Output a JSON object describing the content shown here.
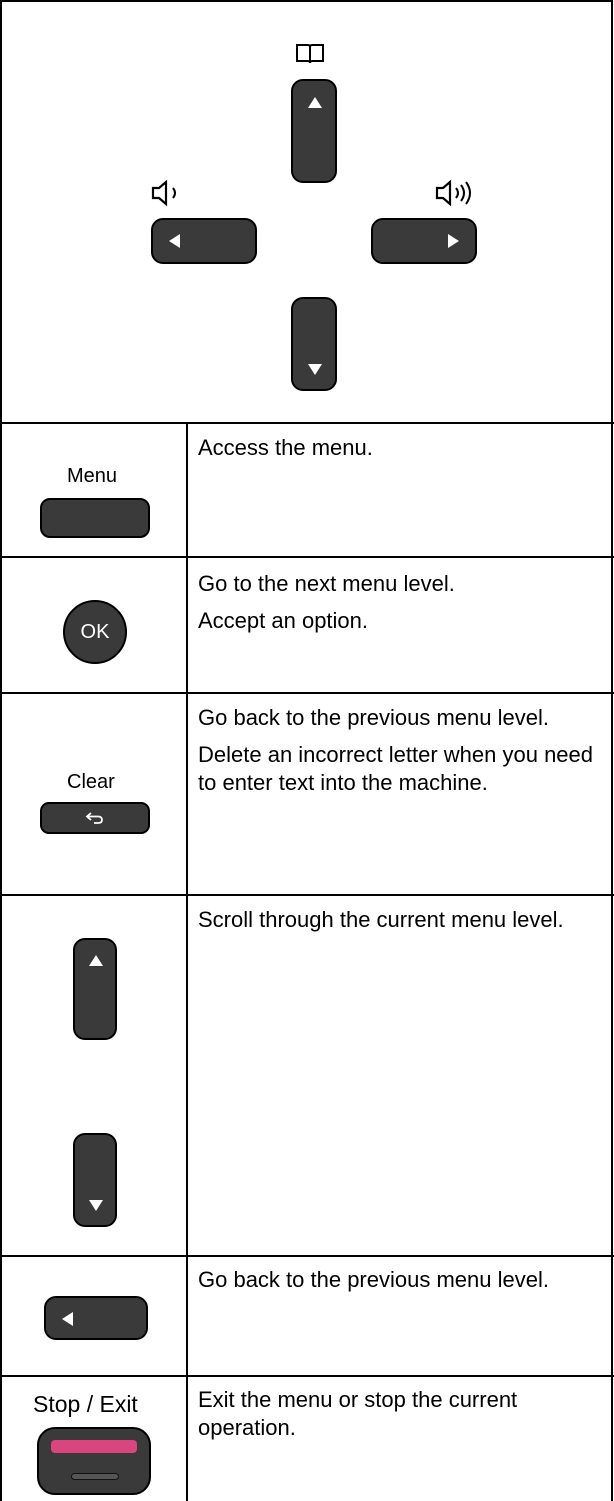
{
  "rows": [
    {
      "key_label": "Menu",
      "lines": [
        "Access the menu."
      ]
    },
    {
      "key_label": "OK",
      "lines": [
        "Go to the next menu level.",
        "Accept an option."
      ]
    },
    {
      "key_label": "Clear",
      "lines": [
        "Go back to the previous menu level.",
        "Delete an incorrect letter when you need to enter text into the machine."
      ]
    },
    {
      "key_label": "",
      "lines": [
        "Scroll through the current menu level."
      ]
    },
    {
      "key_label": "",
      "lines": [
        "Go back to the previous menu level."
      ]
    },
    {
      "key_label": "Stop / Exit",
      "lines": [
        "Exit the menu or stop the current operation."
      ]
    }
  ],
  "icons": {
    "top": "address-book-icon",
    "left": "volume-low-icon",
    "right": "volume-high-icon"
  },
  "colors": {
    "key_fill": "#3a3a3a",
    "stop_bar": "#d9457e"
  }
}
